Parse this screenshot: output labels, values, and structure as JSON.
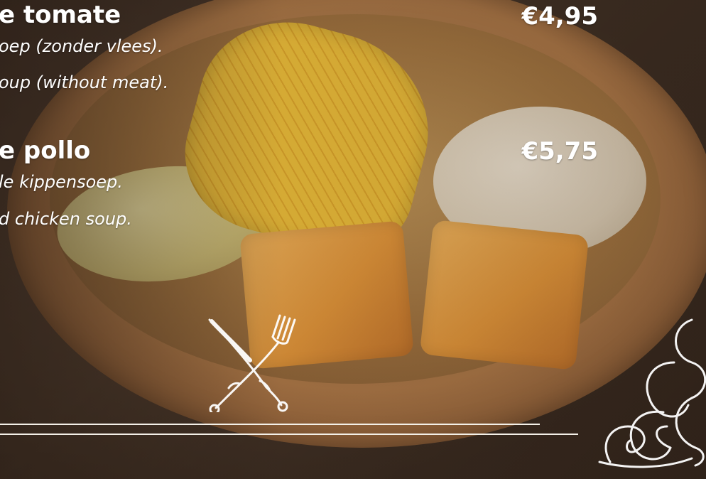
{
  "menu": {
    "items": [
      {
        "title": "e tomate",
        "price": "€4,95",
        "description_nl": "oep (zonder vlees).",
        "description_en": "oup (without meat)."
      },
      {
        "title": "e pollo",
        "price": "€5,75",
        "description_nl": "le kippensoep.",
        "description_en": "d chicken soup."
      }
    ]
  },
  "icons": {
    "cutlery": "knife-fork-crossed-icon",
    "ornament": "scroll-flourish-icon"
  },
  "colors": {
    "text": "#ffffff",
    "rule": "#f4f0e8"
  }
}
